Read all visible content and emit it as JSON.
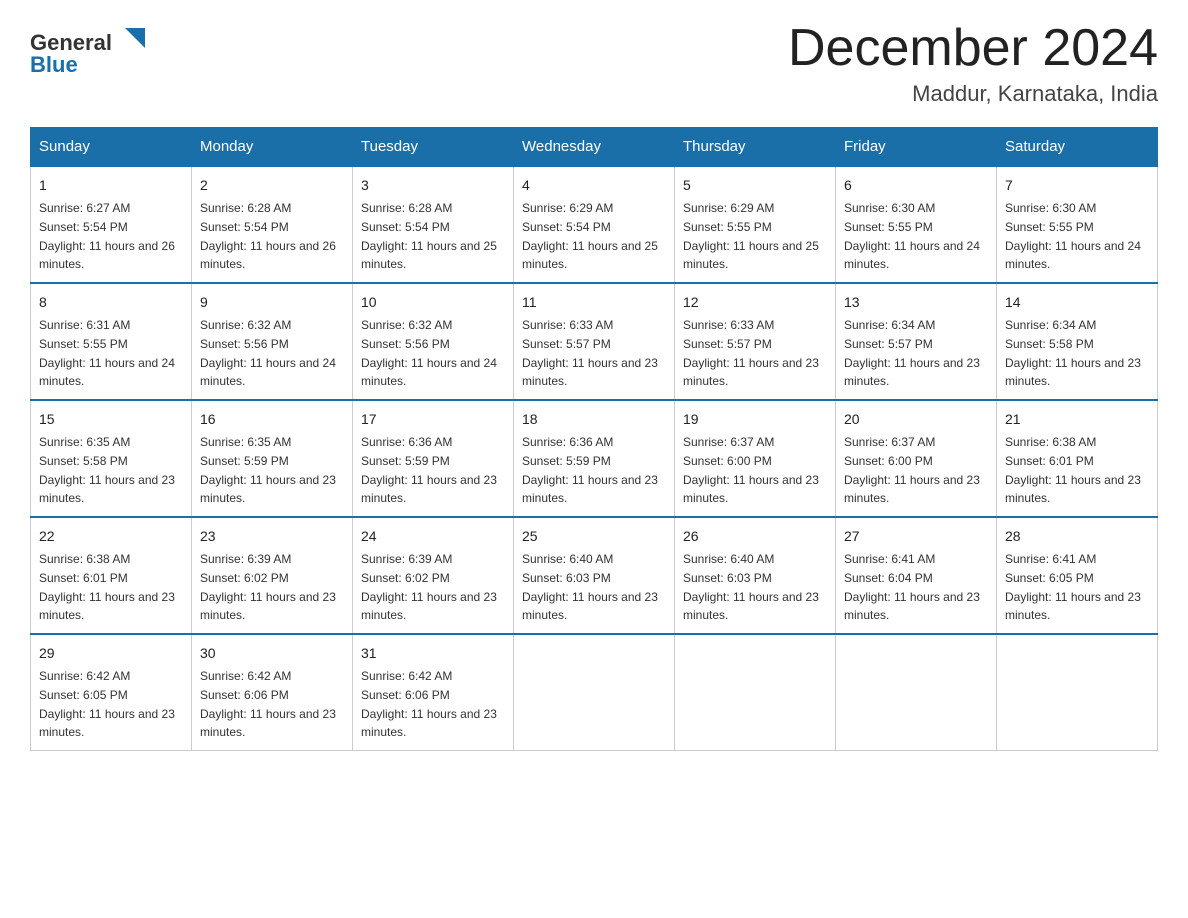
{
  "logo": {
    "text_general": "General",
    "text_blue": "Blue",
    "arrow_color": "#1a6fa8"
  },
  "title": "December 2024",
  "subtitle": "Maddur, Karnataka, India",
  "days_of_week": [
    "Sunday",
    "Monday",
    "Tuesday",
    "Wednesday",
    "Thursday",
    "Friday",
    "Saturday"
  ],
  "weeks": [
    [
      {
        "day": "1",
        "sunrise": "6:27 AM",
        "sunset": "5:54 PM",
        "daylight": "11 hours and 26 minutes."
      },
      {
        "day": "2",
        "sunrise": "6:28 AM",
        "sunset": "5:54 PM",
        "daylight": "11 hours and 26 minutes."
      },
      {
        "day": "3",
        "sunrise": "6:28 AM",
        "sunset": "5:54 PM",
        "daylight": "11 hours and 25 minutes."
      },
      {
        "day": "4",
        "sunrise": "6:29 AM",
        "sunset": "5:54 PM",
        "daylight": "11 hours and 25 minutes."
      },
      {
        "day": "5",
        "sunrise": "6:29 AM",
        "sunset": "5:55 PM",
        "daylight": "11 hours and 25 minutes."
      },
      {
        "day": "6",
        "sunrise": "6:30 AM",
        "sunset": "5:55 PM",
        "daylight": "11 hours and 24 minutes."
      },
      {
        "day": "7",
        "sunrise": "6:30 AM",
        "sunset": "5:55 PM",
        "daylight": "11 hours and 24 minutes."
      }
    ],
    [
      {
        "day": "8",
        "sunrise": "6:31 AM",
        "sunset": "5:55 PM",
        "daylight": "11 hours and 24 minutes."
      },
      {
        "day": "9",
        "sunrise": "6:32 AM",
        "sunset": "5:56 PM",
        "daylight": "11 hours and 24 minutes."
      },
      {
        "day": "10",
        "sunrise": "6:32 AM",
        "sunset": "5:56 PM",
        "daylight": "11 hours and 24 minutes."
      },
      {
        "day": "11",
        "sunrise": "6:33 AM",
        "sunset": "5:57 PM",
        "daylight": "11 hours and 23 minutes."
      },
      {
        "day": "12",
        "sunrise": "6:33 AM",
        "sunset": "5:57 PM",
        "daylight": "11 hours and 23 minutes."
      },
      {
        "day": "13",
        "sunrise": "6:34 AM",
        "sunset": "5:57 PM",
        "daylight": "11 hours and 23 minutes."
      },
      {
        "day": "14",
        "sunrise": "6:34 AM",
        "sunset": "5:58 PM",
        "daylight": "11 hours and 23 minutes."
      }
    ],
    [
      {
        "day": "15",
        "sunrise": "6:35 AM",
        "sunset": "5:58 PM",
        "daylight": "11 hours and 23 minutes."
      },
      {
        "day": "16",
        "sunrise": "6:35 AM",
        "sunset": "5:59 PM",
        "daylight": "11 hours and 23 minutes."
      },
      {
        "day": "17",
        "sunrise": "6:36 AM",
        "sunset": "5:59 PM",
        "daylight": "11 hours and 23 minutes."
      },
      {
        "day": "18",
        "sunrise": "6:36 AM",
        "sunset": "5:59 PM",
        "daylight": "11 hours and 23 minutes."
      },
      {
        "day": "19",
        "sunrise": "6:37 AM",
        "sunset": "6:00 PM",
        "daylight": "11 hours and 23 minutes."
      },
      {
        "day": "20",
        "sunrise": "6:37 AM",
        "sunset": "6:00 PM",
        "daylight": "11 hours and 23 minutes."
      },
      {
        "day": "21",
        "sunrise": "6:38 AM",
        "sunset": "6:01 PM",
        "daylight": "11 hours and 23 minutes."
      }
    ],
    [
      {
        "day": "22",
        "sunrise": "6:38 AM",
        "sunset": "6:01 PM",
        "daylight": "11 hours and 23 minutes."
      },
      {
        "day": "23",
        "sunrise": "6:39 AM",
        "sunset": "6:02 PM",
        "daylight": "11 hours and 23 minutes."
      },
      {
        "day": "24",
        "sunrise": "6:39 AM",
        "sunset": "6:02 PM",
        "daylight": "11 hours and 23 minutes."
      },
      {
        "day": "25",
        "sunrise": "6:40 AM",
        "sunset": "6:03 PM",
        "daylight": "11 hours and 23 minutes."
      },
      {
        "day": "26",
        "sunrise": "6:40 AM",
        "sunset": "6:03 PM",
        "daylight": "11 hours and 23 minutes."
      },
      {
        "day": "27",
        "sunrise": "6:41 AM",
        "sunset": "6:04 PM",
        "daylight": "11 hours and 23 minutes."
      },
      {
        "day": "28",
        "sunrise": "6:41 AM",
        "sunset": "6:05 PM",
        "daylight": "11 hours and 23 minutes."
      }
    ],
    [
      {
        "day": "29",
        "sunrise": "6:42 AM",
        "sunset": "6:05 PM",
        "daylight": "11 hours and 23 minutes."
      },
      {
        "day": "30",
        "sunrise": "6:42 AM",
        "sunset": "6:06 PM",
        "daylight": "11 hours and 23 minutes."
      },
      {
        "day": "31",
        "sunrise": "6:42 AM",
        "sunset": "6:06 PM",
        "daylight": "11 hours and 23 minutes."
      },
      null,
      null,
      null,
      null
    ]
  ],
  "labels": {
    "sunrise": "Sunrise:",
    "sunset": "Sunset:",
    "daylight": "Daylight:"
  }
}
